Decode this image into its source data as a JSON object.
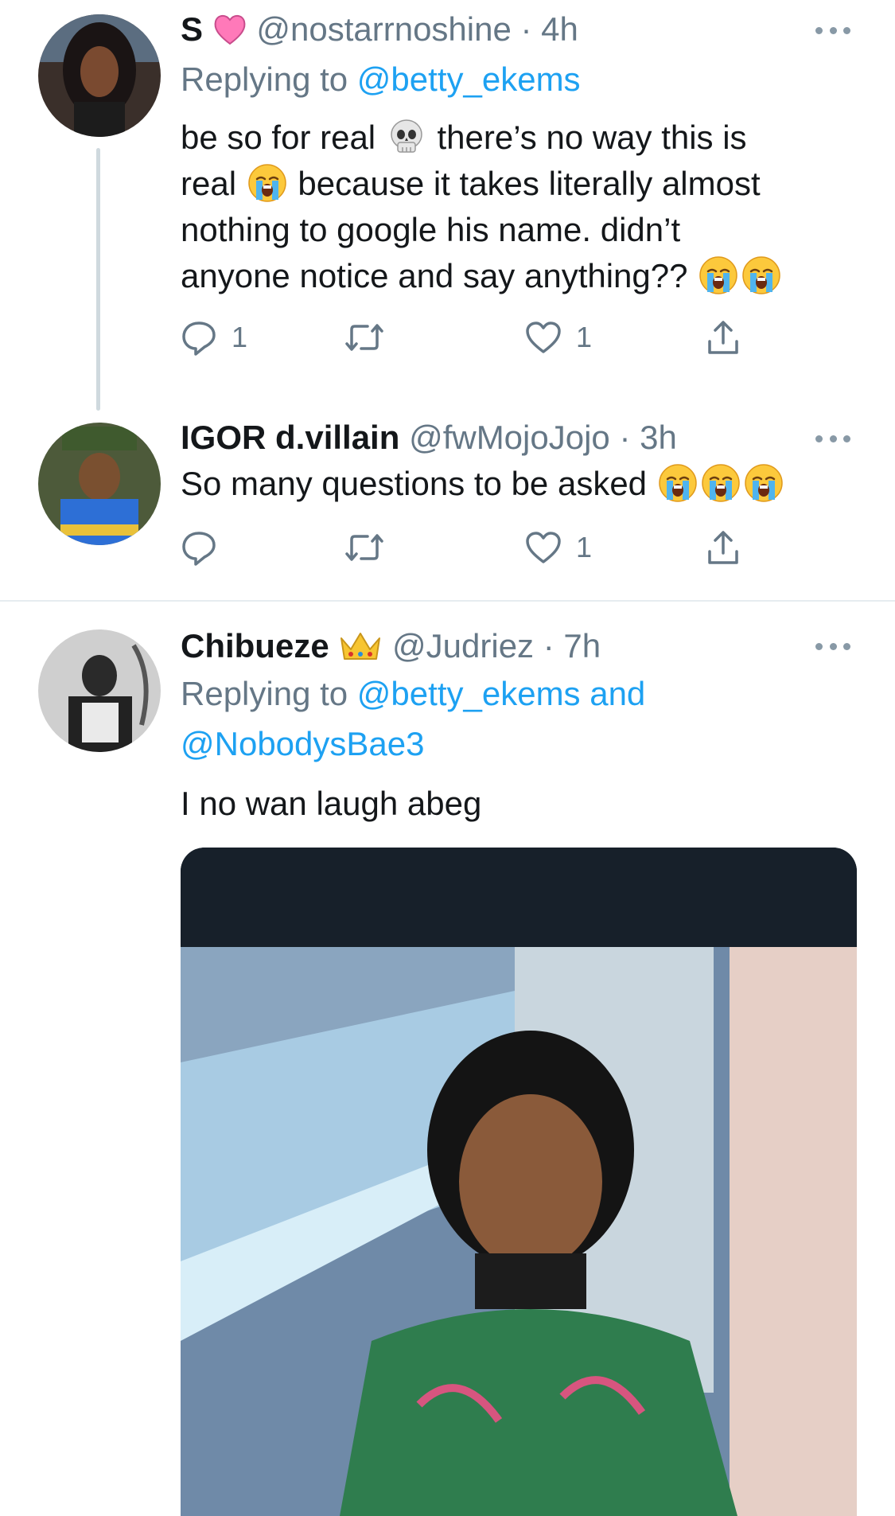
{
  "tweets": [
    {
      "name": "S",
      "handle": "@nostarrnoshine",
      "time": "· 4h",
      "replying_prefix": "Replying to",
      "replying_to": "@betty_ekems",
      "text_lines": [
        "be so for real",
        "there’s no way this is",
        "real",
        "because it takes literally almost",
        "nothing to google his name. didn’t",
        "anyone notice and say anything??"
      ],
      "reply_count": "1",
      "retweet_count": "",
      "like_count": "1"
    },
    {
      "name": "IGOR d.villain",
      "handle": "@fwMojoJojo",
      "time": "· 3h",
      "text": "So many questions to be asked",
      "reply_count": "",
      "retweet_count": "",
      "like_count": "1"
    },
    {
      "name": "Chibueze",
      "handle": "@Judriez",
      "time": "· 7h",
      "replying_prefix": "Replying to",
      "replying_to": "@betty_ekems and",
      "replying_to_2": "@NobodysBae3",
      "text": "I no wan laugh abeg"
    }
  ],
  "colors": {
    "link": "#1da1f2",
    "secondary_text": "#657786",
    "thread_line": "#cfd9de",
    "separator": "#e6ecf0"
  },
  "icons": [
    "more-icon",
    "reply-icon",
    "retweet-icon",
    "like-icon",
    "share-icon",
    "heart-emoji",
    "skull-emoji",
    "crying-emoji",
    "crown-emoji"
  ]
}
